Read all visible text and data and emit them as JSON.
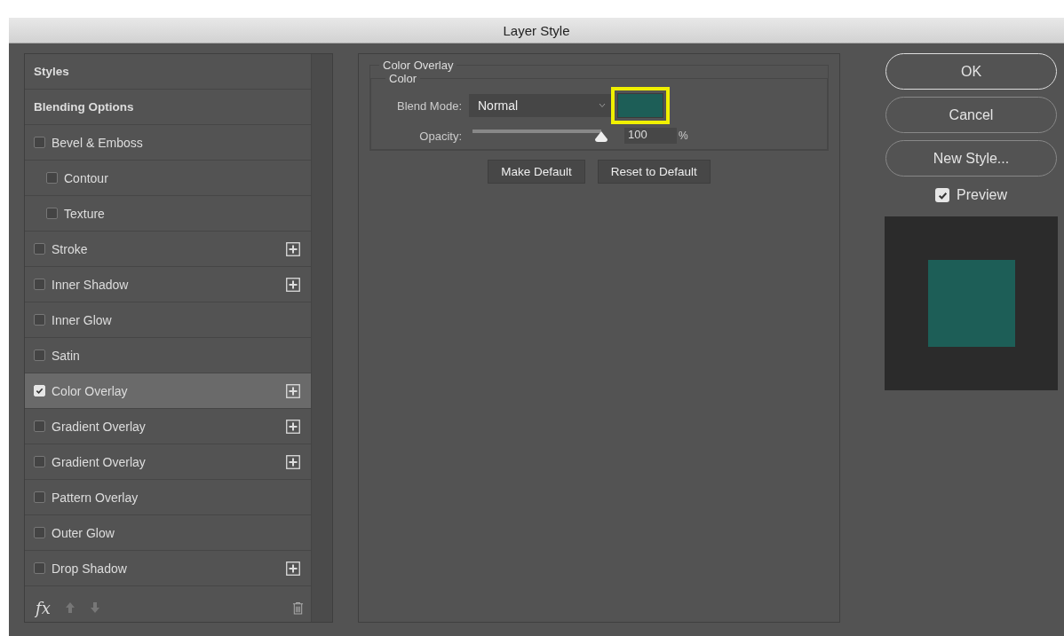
{
  "window": {
    "title": "Layer Style"
  },
  "styles_list": [
    {
      "label": "Styles",
      "kind": "header",
      "selected": false,
      "plus": false
    },
    {
      "label": "Blending Options",
      "kind": "header",
      "selected": false,
      "plus": false
    },
    {
      "label": "Bevel & Emboss",
      "kind": "effect",
      "checked": false,
      "selected": false,
      "plus": false,
      "children": [
        {
          "label": "Contour",
          "kind": "effect",
          "checked": false,
          "selected": false,
          "plus": false
        },
        {
          "label": "Texture",
          "kind": "effect",
          "checked": false,
          "selected": false,
          "plus": false
        }
      ]
    },
    {
      "label": "Stroke",
      "kind": "effect",
      "checked": false,
      "selected": false,
      "plus": true
    },
    {
      "label": "Inner Shadow",
      "kind": "effect",
      "checked": false,
      "selected": false,
      "plus": true
    },
    {
      "label": "Inner Glow",
      "kind": "effect",
      "checked": false,
      "selected": false,
      "plus": false
    },
    {
      "label": "Satin",
      "kind": "effect",
      "checked": false,
      "selected": false,
      "plus": false
    },
    {
      "label": "Color Overlay",
      "kind": "effect",
      "checked": true,
      "selected": true,
      "plus": true
    },
    {
      "label": "Gradient Overlay",
      "kind": "effect",
      "checked": false,
      "selected": false,
      "plus": true
    },
    {
      "label": "Gradient Overlay",
      "kind": "effect",
      "checked": false,
      "selected": false,
      "plus": true
    },
    {
      "label": "Pattern Overlay",
      "kind": "effect",
      "checked": false,
      "selected": false,
      "plus": false
    },
    {
      "label": "Outer Glow",
      "kind": "effect",
      "checked": false,
      "selected": false,
      "plus": false
    },
    {
      "label": "Drop Shadow",
      "kind": "effect",
      "checked": false,
      "selected": false,
      "plus": true
    }
  ],
  "list_toolbar": {
    "fx": "fx"
  },
  "panel": {
    "title": "Color Overlay",
    "group": "Color",
    "blend_mode_label": "Blend Mode:",
    "blend_mode": "Normal",
    "color": "#1d5e57",
    "opacity_label": "Opacity:",
    "opacity": {
      "level": 1
    },
    "opacity_value": "100",
    "opacity_unit": "%",
    "buttons": [
      "Make Default",
      "Reset to Default"
    ]
  },
  "actions": [
    "OK",
    "Cancel",
    "New Style..."
  ],
  "preview": {
    "label": "Preview",
    "checked": true,
    "color": "#1d5e57"
  }
}
